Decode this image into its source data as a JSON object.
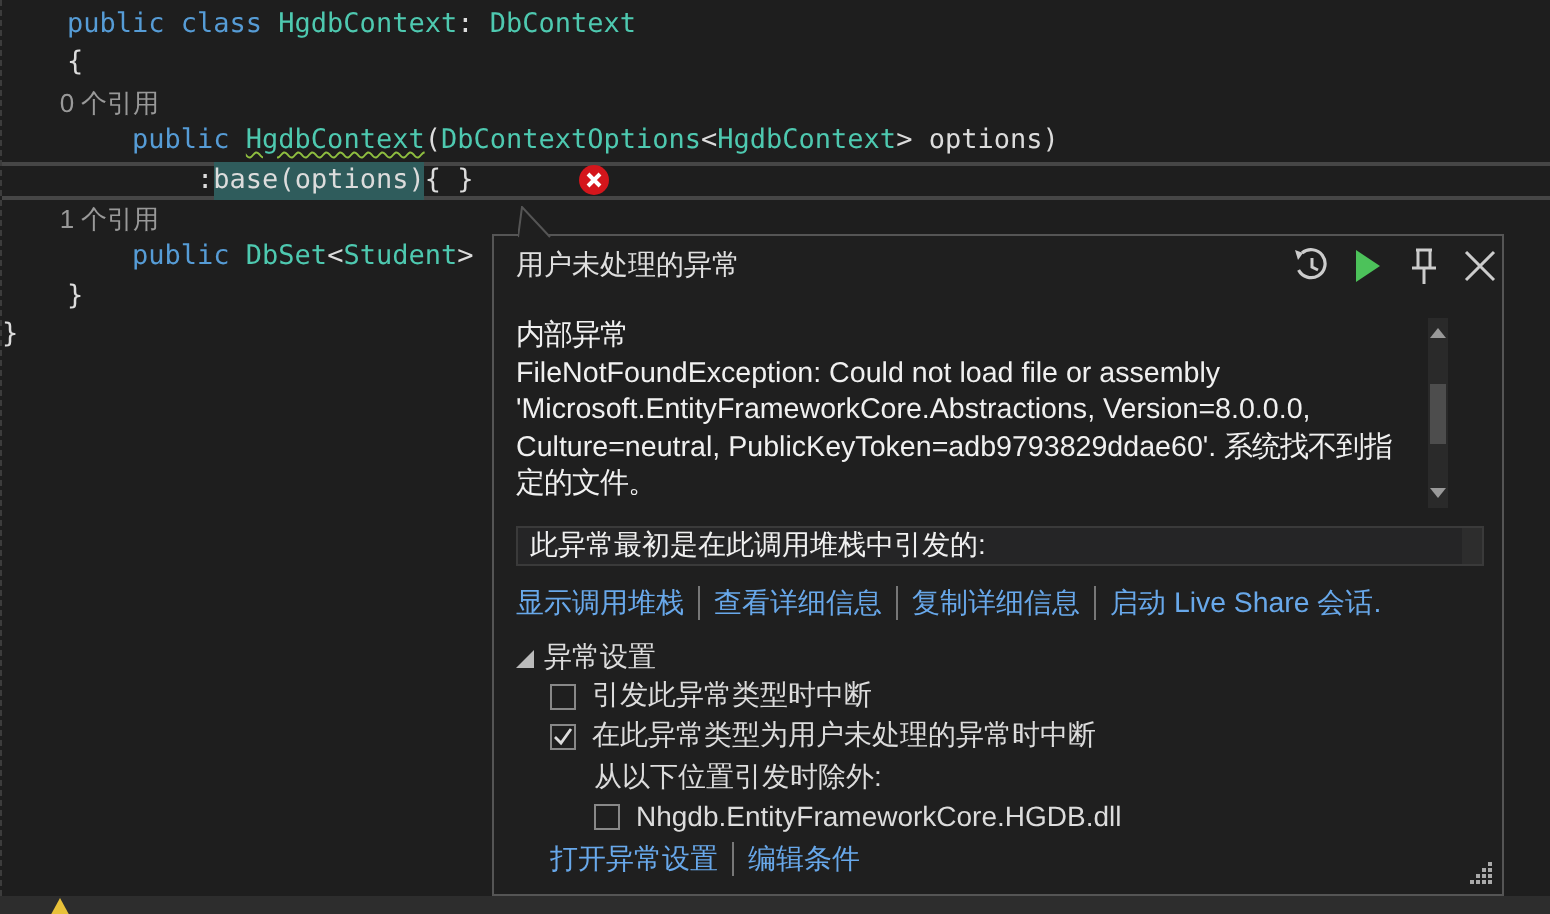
{
  "code_lines": [
    {
      "kind": "code",
      "current": false,
      "tokens": [
        {
          "kind": "keyword",
          "text": "    public class "
        },
        {
          "kind": "type",
          "text": "HgdbContext"
        },
        {
          "kind": "plain",
          "text": ": "
        },
        {
          "kind": "type",
          "text": "DbContext"
        }
      ]
    },
    {
      "kind": "code",
      "current": false,
      "tokens": [
        {
          "kind": "plain",
          "text": "    {"
        }
      ]
    },
    {
      "kind": "codelens",
      "current": false,
      "tokens": [
        {
          "kind": "lens",
          "text": "        0 个引用"
        }
      ]
    },
    {
      "kind": "code",
      "current": false,
      "tokens": [
        {
          "kind": "keyword",
          "text": "        public "
        },
        {
          "kind": "type",
          "text": "HgdbContext",
          "squiggle": true
        },
        {
          "kind": "plain",
          "text": "("
        },
        {
          "kind": "type",
          "text": "DbContextOptions"
        },
        {
          "kind": "plain",
          "text": "<"
        },
        {
          "kind": "type",
          "text": "HgdbContext"
        },
        {
          "kind": "plain",
          "text": "> options)"
        }
      ]
    },
    {
      "kind": "code",
      "current": true,
      "error": true,
      "tokens": [
        {
          "kind": "plain",
          "text": "            :"
        },
        {
          "kind": "highlight",
          "text": "base"
        },
        {
          "kind": "highlight",
          "text": "(options)"
        },
        {
          "kind": "plain",
          "text": "{ }"
        }
      ]
    },
    {
      "kind": "codelens",
      "current": false,
      "tokens": [
        {
          "kind": "lens",
          "text": "        1 个引用"
        }
      ]
    },
    {
      "kind": "code",
      "current": false,
      "tokens": [
        {
          "kind": "keyword",
          "text": "        public "
        },
        {
          "kind": "type",
          "text": "DbSet"
        },
        {
          "kind": "plain",
          "text": "<"
        },
        {
          "kind": "type",
          "text": "Student"
        },
        {
          "kind": "plain",
          "text": ">"
        }
      ]
    },
    {
      "kind": "code",
      "current": false,
      "tokens": [
        {
          "kind": "plain",
          "text": "    }"
        }
      ]
    },
    {
      "kind": "code",
      "current": false,
      "tokens": [
        {
          "kind": "plain",
          "text": "}"
        }
      ]
    }
  ],
  "exception_popup": {
    "title": "用户未处理的异常",
    "inner_exception": {
      "heading": "内部异常",
      "message": "FileNotFoundException: Could not load file or assembly 'Microsoft.EntityFrameworkCore.Abstractions, Version=8.0.0.0, Culture=neutral, PublicKeyToken=adb9793829ddae60'. 系统找不到指定的文件。"
    },
    "stack_header": "此异常最初是在此调用堆栈中引发的:",
    "actions": [
      "显示调用堆栈",
      "查看详细信息",
      "复制详细信息",
      "启动 Live Share 会话."
    ],
    "settings": {
      "label": "异常设置",
      "expanded": true,
      "options": [
        {
          "label": "引发此异常类型时中断",
          "checked": false
        },
        {
          "label": "在此异常类型为用户未处理的异常时中断",
          "checked": true
        }
      ],
      "except_label": "从以下位置引发时除外:",
      "modules": [
        {
          "label": "Nhgdb.EntityFrameworkCore.HGDB.dll",
          "checked": false
        }
      ]
    },
    "footer_links": [
      "打开异常设置",
      "编辑条件"
    ]
  }
}
